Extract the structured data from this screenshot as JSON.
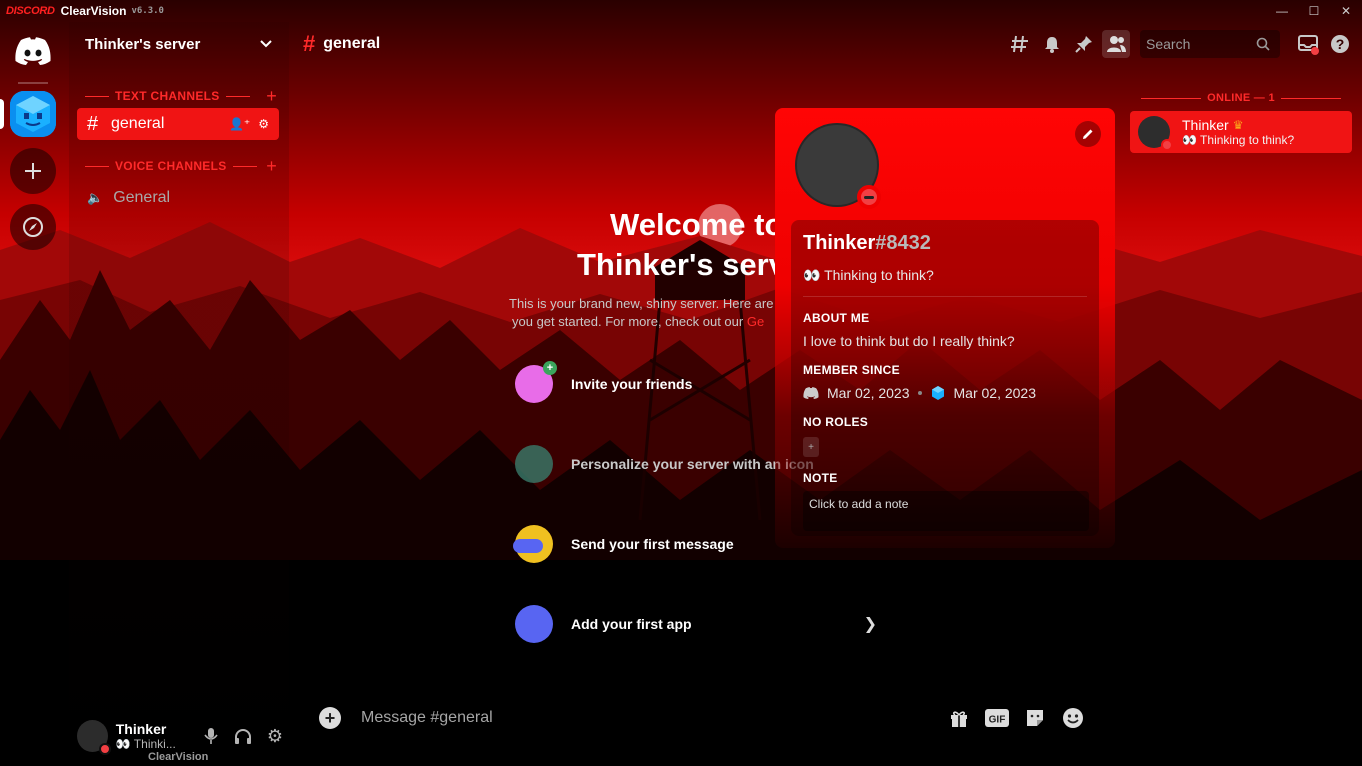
{
  "titlebar": {
    "brand": "DISCORD",
    "app": "ClearVision",
    "version": "v6.3.0"
  },
  "server": {
    "name": "Thinker's server"
  },
  "sidebar": {
    "categories": [
      {
        "label": "TEXT CHANNELS",
        "channels": [
          {
            "name": "general",
            "type": "text",
            "active": true
          }
        ]
      },
      {
        "label": "VOICE CHANNELS",
        "channels": [
          {
            "name": "General",
            "type": "voice",
            "active": false
          }
        ]
      }
    ]
  },
  "user_panel": {
    "name": "Thinker",
    "status": "👀 Thinki...",
    "footer": "ClearVision"
  },
  "chat": {
    "channel": "general",
    "search_placeholder": "Search",
    "composer_placeholder": "Message #general"
  },
  "welcome": {
    "title_line1": "Welcome to",
    "title_line2": "Thinker's server",
    "desc_line1": "This is your brand new, shiny server. Here are",
    "desc_line2_pre": "you get started. For more, check out our ",
    "desc_link": "Ge",
    "items": [
      {
        "label": "Invite your friends",
        "dim": false
      },
      {
        "label": "Personalize your server with an icon",
        "dim": true
      },
      {
        "label": "Send your first message",
        "dim": false
      },
      {
        "label": "Add your first app",
        "dim": false
      }
    ]
  },
  "profile": {
    "username": "Thinker",
    "discriminator": "#8432",
    "custom_status": "👀 Thinking to think?",
    "about_heading": "ABOUT ME",
    "about_text": "I love to think but do I really think?",
    "member_since_heading": "MEMBER SINCE",
    "discord_since": "Mar 02, 2023",
    "server_since": "Mar 02, 2023",
    "roles_heading": "NO ROLES",
    "note_heading": "NOTE",
    "note_placeholder": "Click to add a note"
  },
  "members": {
    "category": "ONLINE — 1",
    "list": [
      {
        "name": "Thinker",
        "status": "👀 Thinking to think?",
        "owner": true
      }
    ]
  },
  "colors": {
    "accent": "#f01414",
    "category_text": "#ff2a2a",
    "dnd": "#f23f43",
    "server_icon": "#0aa3ff"
  },
  "icons": {
    "titlebar": [
      "minimize-icon",
      "maximize-icon",
      "close-icon"
    ],
    "header_tools": [
      "threads-icon",
      "bell-icon",
      "pin-icon",
      "members-icon",
      "search-icon",
      "inbox-icon",
      "help-icon"
    ],
    "composer": [
      "gift-icon",
      "gif-icon",
      "sticker-icon",
      "emoji-icon"
    ],
    "user_panel": [
      "microphone-icon",
      "headphones-icon",
      "settings-icon"
    ]
  }
}
